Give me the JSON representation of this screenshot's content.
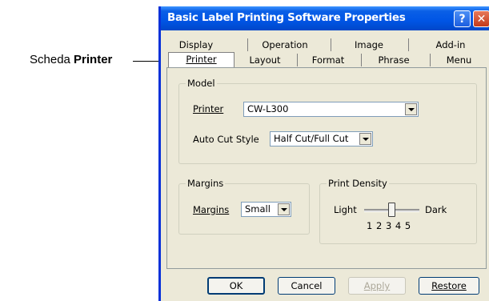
{
  "callout": {
    "prefix": "Scheda ",
    "bold": "Printer"
  },
  "dialog": {
    "title": "Basic Label Printing Software Properties",
    "help_glyph": "?",
    "close_glyph": "✕"
  },
  "tabs_back": [
    "Display",
    "Operation",
    "Image",
    "Add-in"
  ],
  "tabs_front": [
    "Printer",
    "Layout",
    "Format",
    "Phrase",
    "Menu"
  ],
  "model": {
    "group_label": "Model",
    "printer_label": "Printer",
    "printer_value": "CW-L300",
    "autocut_label": "Auto Cut Style",
    "autocut_value": "Half Cut/Full Cut"
  },
  "margins": {
    "group_label": "Margins",
    "label": "Margins",
    "value": "Small"
  },
  "density": {
    "group_label": "Print Density",
    "light": "Light",
    "dark": "Dark",
    "scale": "1 2 3 4 5",
    "level": 3
  },
  "buttons": {
    "ok": "OK",
    "cancel": "Cancel",
    "apply": "Apply",
    "restore": "Restore"
  }
}
